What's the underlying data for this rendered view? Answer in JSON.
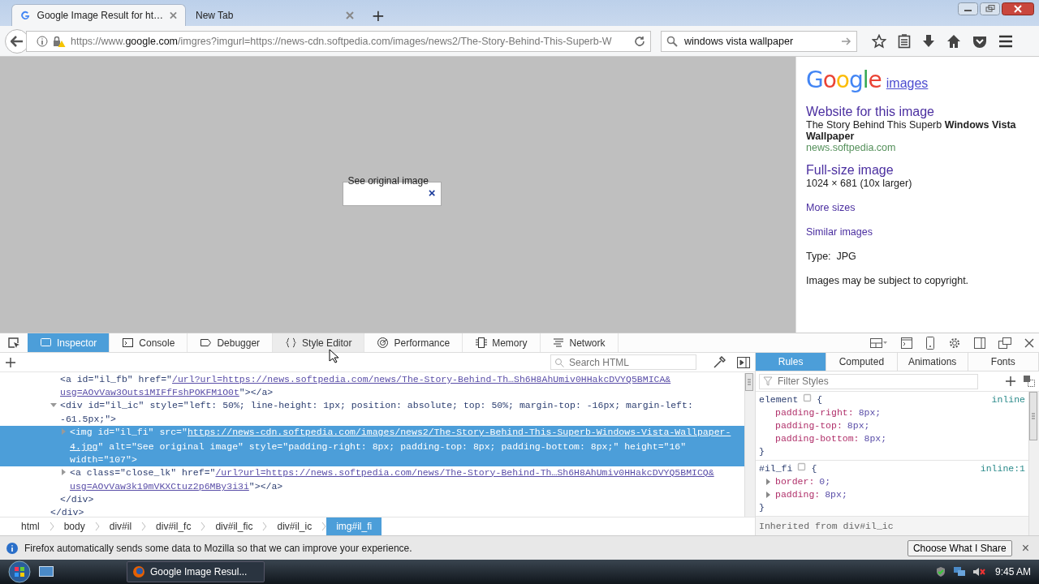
{
  "browser_tabs": [
    {
      "title": "Google Image Result for ht…",
      "selected": true
    },
    {
      "title": "New Tab",
      "selected": false
    }
  ],
  "new_tab": "+",
  "address_bar": {
    "url_start": "https://www.",
    "url_domain": "google.com",
    "url_rest": "/imgres?imgurl=https://news-cdn.softpedia.com/images/news2/The-Story-Behind-This-Superb-W"
  },
  "search_bar": {
    "value": "windows vista wallpaper"
  },
  "image_popup": {
    "alt_text": "See original image",
    "close": "×"
  },
  "info_panel": {
    "logo": "Google",
    "images_link": "images",
    "website": {
      "heading": "Website for this image",
      "description": "The Story Behind This Superb **Windows Vista Wallpaper**",
      "domain": "news.softpedia.com"
    },
    "full_size": {
      "heading": "Full-size image",
      "dimensions": "1024 × 681 (10x larger)"
    },
    "links": [
      "More sizes",
      "Similar images"
    ],
    "type": "Type:  JPG",
    "notice": "Images may be subject to copyright."
  },
  "devtools": {
    "tabs": [
      {
        "label": "Inspector",
        "selected": true
      },
      {
        "label": "Console",
        "selected": false
      },
      {
        "label": "Debugger",
        "selected": false
      },
      {
        "label": "Style Editor",
        "selected": false
      },
      {
        "label": "Performance",
        "selected": false
      },
      {
        "label": "Memory",
        "selected": false
      },
      {
        "label": "Network",
        "selected": false
      }
    ],
    "search_html": {
      "placeholder": "Search HTML"
    },
    "markup": {
      "nodes": [
        {
          "kind": "leaf",
          "selected": false,
          "lines": [
            [
              {
                "kind": "code",
                "text": "<a id=\"il_fb\" href=\""
              },
              {
                "kind": "link",
                "text": "/url?url=https://news.softpedia.com/news/The-Story-Behind-Th…Sh6H8AhUmiv0HHakcDVYQ5BMICA&"
              }
            ],
            [
              {
                "kind": "link",
                "text": "usg=AOvVaw3Outs1MIFfFshPOKFM1O0t"
              },
              {
                "kind": "code",
                "text": "\"></a>"
              }
            ]
          ]
        },
        {
          "kind": "element",
          "expanded": true,
          "selected": false,
          "lines": [
            [
              {
                "kind": "code",
                "text": "<div id=\"il_ic\" style=\"left: 50%; line-height: 1px; position: absolute; top: 50%; margin-top: -16px; margin-left:"
              }
            ],
            [
              {
                "kind": "code",
                "text": "-61.5px;\">"
              }
            ]
          ],
          "children": [
            {
              "kind": "element",
              "expanded": false,
              "selected": true,
              "lines": [
                [
                  {
                    "kind": "code",
                    "text": "<img id=\"il_fi\" src=\""
                  },
                  {
                    "kind": "link",
                    "text": "https://news-cdn.softpedia.com/images/news2/The-Story-Behind-This-Superb-Windows-Vista-Wallpaper-"
                  }
                ],
                [
                  {
                    "kind": "link",
                    "text": "4.jpg"
                  },
                  {
                    "kind": "code",
                    "text": "\" alt=\"See original image\" style=\"padding-right: 8px; padding-top: 8px; padding-bottom: 8px;\" height=\"16\""
                  }
                ],
                [
                  {
                    "kind": "code",
                    "text": "width=\"107\">"
                  }
                ]
              ]
            },
            {
              "kind": "element",
              "expanded": false,
              "selected": false,
              "lines": [
                [
                  {
                    "kind": "code",
                    "text": "<a class=\"close_lk\" href=\""
                  },
                  {
                    "kind": "link",
                    "text": "/url?url=https://news.softpedia.com/news/The-Story-Behind-Th…Sh6H8AhUmiv0HHakcDVYQ5BMICQ&"
                  }
                ],
                [
                  {
                    "kind": "link",
                    "text": "usg=AOvVaw3k19mVKXCtuz2p6MBy3i3i"
                  },
                  {
                    "kind": "code",
                    "text": "\"></a>"
                  }
                ]
              ]
            }
          ],
          "close": "</div>"
        }
      ],
      "close": "</div>"
    },
    "breadcrumbs": [
      {
        "label": "html",
        "selected": false
      },
      {
        "label": "body",
        "selected": false
      },
      {
        "label": "div#il",
        "selected": false
      },
      {
        "label": "div#il_fc",
        "selected": false
      },
      {
        "label": "div#il_fic",
        "selected": false
      },
      {
        "label": "div#il_ic",
        "selected": false
      },
      {
        "label": "img#il_fi",
        "selected": true
      }
    ],
    "sidebar_tabs": [
      {
        "label": "Rules",
        "selected": true
      },
      {
        "label": "Computed",
        "selected": false
      },
      {
        "label": "Animations",
        "selected": false
      },
      {
        "label": "Fonts",
        "selected": false
      }
    ],
    "filter_styles": {
      "placeholder": "Filter Styles"
    },
    "rules": [
      {
        "selector": "element",
        "open": "{",
        "source": "inline",
        "close": "}",
        "declarations": [
          {
            "kind": "longhand",
            "property": "padding-right:",
            "value": "8px;"
          },
          {
            "kind": "longhand",
            "property": "padding-top:",
            "value": "8px;"
          },
          {
            "kind": "longhand",
            "property": "padding-bottom:",
            "value": "8px;"
          }
        ]
      },
      {
        "selector": "#il_fi",
        "open": "{",
        "source": "inline:1",
        "close": "}",
        "declarations": [
          {
            "kind": "shorthand",
            "property": "border:",
            "value": "0;"
          },
          {
            "kind": "shorthand",
            "property": "padding:",
            "value": "8px;"
          }
        ]
      }
    ],
    "inherited_header": "Inherited from div#il_ic"
  },
  "notification": {
    "text": "Firefox automatically sends some data to Mozilla so that we can improve your experience.",
    "button": "Choose What I Share",
    "close": "×"
  },
  "taskbar": {
    "task": "Google Image Resul...",
    "clock": "9:45 AM"
  }
}
